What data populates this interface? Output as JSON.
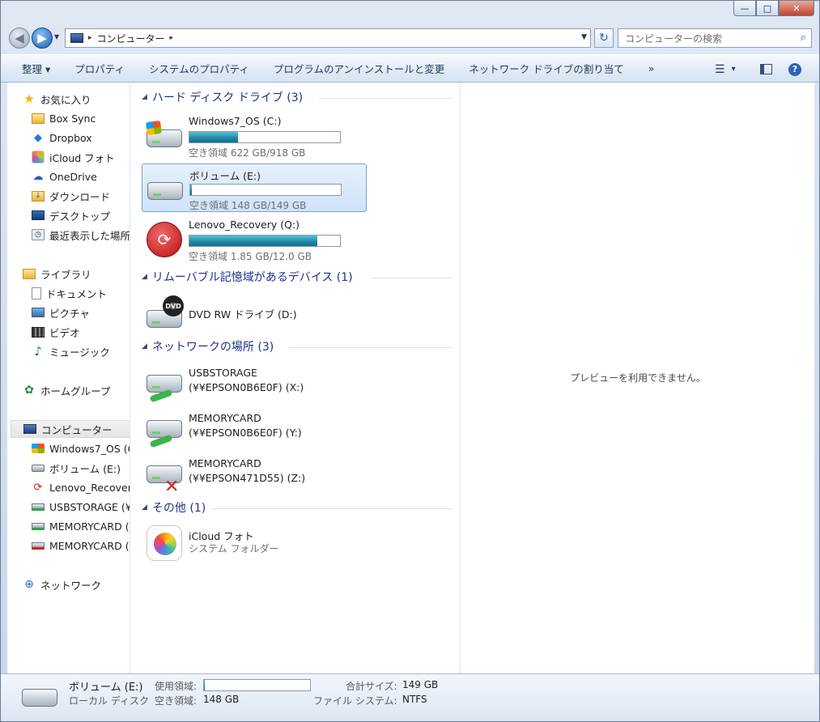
{
  "window": {
    "minimize_glyph": "—",
    "maximize_glyph": "□",
    "close_glyph": "✕"
  },
  "address": {
    "path": "コンピューター",
    "separator": "▸",
    "search_placeholder": "コンピューターの検索"
  },
  "toolbar": {
    "organize": "整理 ▾",
    "properties": "プロパティ",
    "system_properties": "システムのプロパティ",
    "uninstall": "プログラムのアンインストールと変更",
    "map_network_drive": "ネットワーク ドライブの割り当て",
    "more": "»",
    "view": "▾"
  },
  "nav": {
    "favorites": "お気に入り",
    "box_sync": "Box Sync",
    "dropbox": "Dropbox",
    "icloud_photos": "iCloud フォト",
    "onedrive": "OneDrive",
    "downloads": "ダウンロード",
    "desktop": "デスクトップ",
    "recent": "最近表示した場所",
    "libraries": "ライブラリ",
    "documents": "ドキュメント",
    "pictures": "ピクチャ",
    "videos": "ビデオ",
    "music": "ミュージック",
    "homegroup": "ホームグループ",
    "computer": "コンピューター",
    "drive_c": "Windows7_OS (C",
    "drive_e": "ボリューム (E:)",
    "drive_q": "Lenovo_Recovery",
    "drive_x": "USBSTORAGE (¥",
    "drive_y": "MEMORYCARD (¥",
    "drive_z": "MEMORYCARD (¥",
    "network": "ネットワーク"
  },
  "groups": {
    "hdd": "ハード ディスク ドライブ (3)",
    "removable": "リムーバブル記憶域があるデバイス (1)",
    "network": "ネットワークの場所 (3)",
    "other": "その他 (1)"
  },
  "drives": [
    {
      "name": "Windows7_OS (C:)",
      "free": "空き領域 622 GB/918 GB",
      "used_fraction": 0.32
    },
    {
      "name": "ボリューム (E:)",
      "free": "空き領域 148 GB/149 GB",
      "used_fraction": 0.01
    },
    {
      "name": "Lenovo_Recovery (Q:)",
      "free": "空き領域 1.85 GB/12.0 GB",
      "used_fraction": 0.85
    }
  ],
  "removable": {
    "name": "DVD RW ドライブ (D:)",
    "badge": "DVD"
  },
  "network_locations": [
    {
      "line1": "USBSTORAGE",
      "line2": "(¥¥EPSON0B6E0F) (X:)"
    },
    {
      "line1": "MEMORYCARD",
      "line2": "(¥¥EPSON0B6E0F) (Y:)"
    },
    {
      "line1": "MEMORYCARD",
      "line2": "(¥¥EPSON471D55) (Z:)"
    }
  ],
  "other": {
    "name": "iCloud フォト",
    "sub": "システム フォルダー"
  },
  "preview": {
    "text": "プレビューを利用できません。"
  },
  "status": {
    "name": "ボリューム (E:)",
    "used_label": "使用領域:",
    "type": "ローカル ディスク",
    "free_label": "空き領域:",
    "free_value": "148 GB",
    "total_label": "合計サイズ:",
    "total_value": "149 GB",
    "fs_label": "ファイル システム:",
    "fs_value": "NTFS"
  }
}
